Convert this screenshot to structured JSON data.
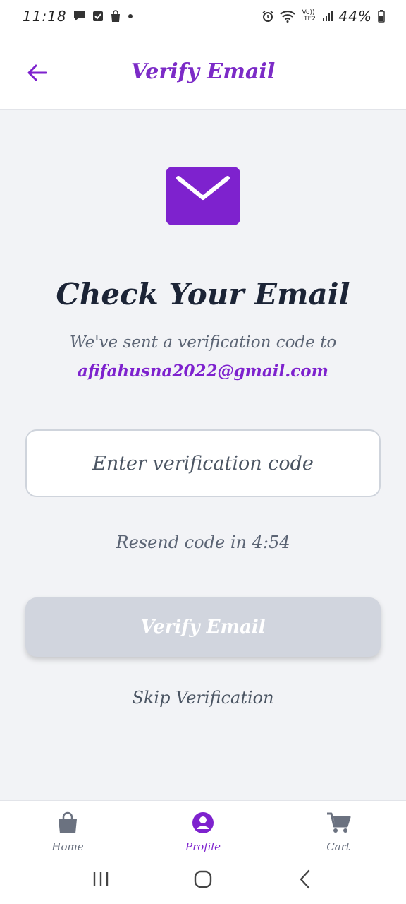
{
  "status_bar": {
    "time": "11:18",
    "battery_text": "44%",
    "network_text": "Vo)) LTE2"
  },
  "app_bar": {
    "title": "Verify Email",
    "back_icon": "arrow-left-icon"
  },
  "content": {
    "headline": "Check Your Email",
    "subtext": "We've sent a verification code to",
    "email": "afifahusna2022@gmail.com",
    "code_input": {
      "placeholder": "Enter verification code",
      "value": ""
    },
    "resend_text": "Resend code in 4:54",
    "verify_button": "Verify Email",
    "skip_link": "Skip Verification"
  },
  "bottom_nav": {
    "items": [
      {
        "label": "Home",
        "icon": "shopping-bag-icon",
        "active": false
      },
      {
        "label": "Profile",
        "icon": "user-circle-icon",
        "active": true
      },
      {
        "label": "Cart",
        "icon": "cart-icon",
        "active": false
      }
    ]
  },
  "colors": {
    "accent": "#7e22ce",
    "heading": "#1c2436",
    "muted": "#5b6474",
    "background": "#f2f3f6",
    "disabled_button": "#d1d5de"
  }
}
